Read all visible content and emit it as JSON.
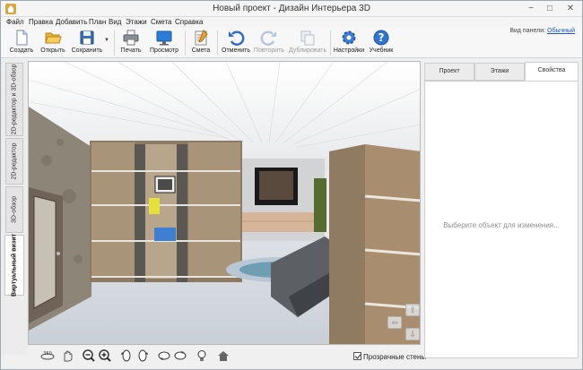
{
  "window": {
    "title": "Новый проект - Дизайн Интерьера 3D",
    "controls": [
      "−",
      "□",
      "✕"
    ]
  },
  "menu": {
    "items": [
      "Файл",
      "Правка",
      "Добавить",
      "План",
      "Вид",
      "Этажи",
      "Смета",
      "Справка"
    ]
  },
  "toolbar": {
    "buttons": [
      {
        "label": "Создать",
        "icon": "new-document-icon"
      },
      {
        "label": "Открыть",
        "icon": "folder-open-icon"
      },
      {
        "label": "Сохранить",
        "icon": "floppy-disk-icon"
      },
      {
        "label": "Печать",
        "icon": "printer-icon"
      },
      {
        "label": "Просмотр",
        "icon": "monitor-preview-icon"
      },
      {
        "label": "Смета",
        "icon": "estimate-notepad-icon"
      },
      {
        "label": "Отменить",
        "icon": "undo-icon"
      },
      {
        "label": "Повторить",
        "icon": "redo-icon"
      },
      {
        "label": "Дублировать",
        "icon": "duplicate-icon"
      },
      {
        "label": "Настройки",
        "icon": "gear-icon"
      },
      {
        "label": "Учебник",
        "icon": "help-icon"
      }
    ],
    "save_dropdown": "▼",
    "panel_view_label": "Вид панели:",
    "panel_view_value": "Обычный"
  },
  "left_tabs": [
    "2D-редактор и 3D-обзор",
    "2D-редактор",
    "3D-обзор",
    "Виртуальный визит"
  ],
  "active_left_tab": "Виртуальный визит",
  "right_panel": {
    "tabs": [
      "Проект",
      "Этажи",
      "Свойства"
    ],
    "active_tab": "Свойства",
    "hint": "Выберите объект для изменения..."
  },
  "bottom_bar": {
    "rotate_label": "360",
    "transparent_walls_label": "Прозрачные стены",
    "transparent_walls_checked": true,
    "icons": [
      "rotate-360-icon",
      "hand-pan-icon",
      "zoom-out-icon",
      "zoom-in-icon",
      "rotate-left-icon",
      "rotate-right-icon",
      "tilt-down-icon",
      "tilt-up-icon",
      "light-bulb-icon",
      "home-icon"
    ]
  },
  "nav_pad": {
    "up": "⇧",
    "down": "⇩",
    "left": "⇦",
    "right": "⇨"
  }
}
